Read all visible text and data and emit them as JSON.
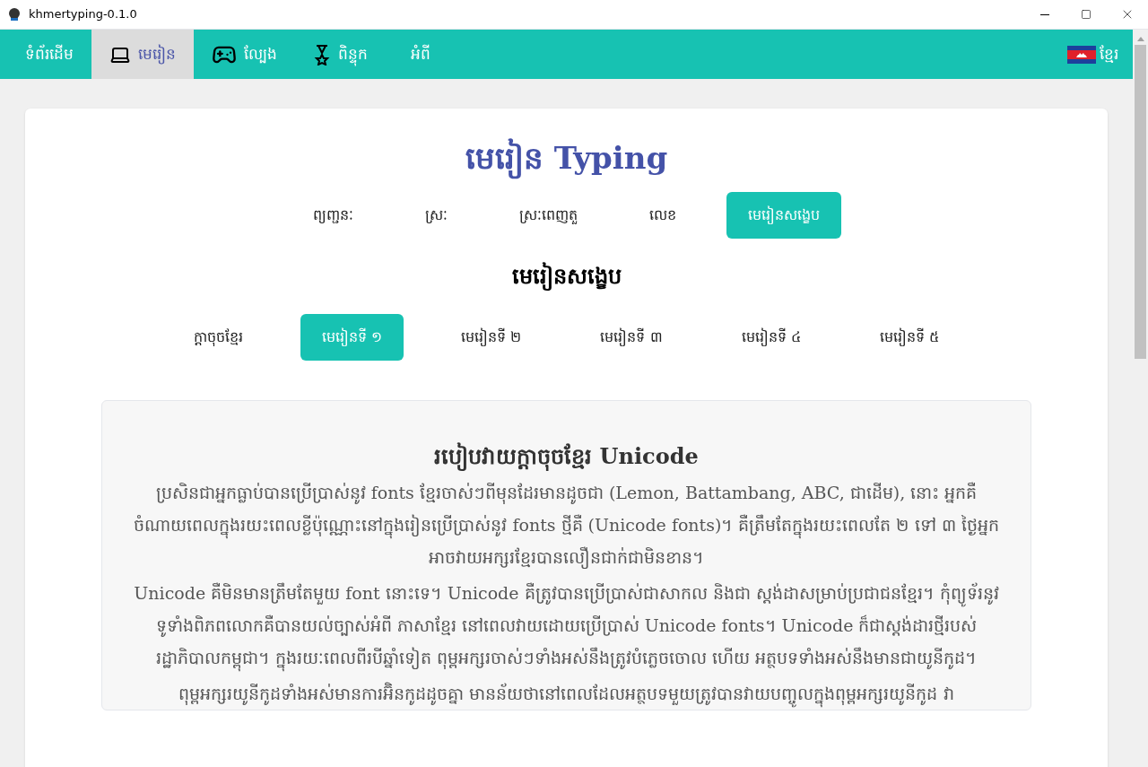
{
  "window": {
    "title": "khmertyping-0.1.0"
  },
  "nav": {
    "items": [
      {
        "label": "ទំព័រដើម",
        "kind": "plain",
        "selected": false
      },
      {
        "label": "មេរៀន",
        "kind": "laptop",
        "selected": true
      },
      {
        "label": "ល្បែង",
        "kind": "gamepad",
        "selected": false
      },
      {
        "label": "ពិន្ទុក",
        "kind": "medal",
        "selected": false
      },
      {
        "label": "អំពី",
        "kind": "plain",
        "selected": false
      }
    ],
    "language": "ខ្មែរ"
  },
  "page": {
    "title": "មេរៀន Typing",
    "categories": [
      {
        "label": "ព្យញ្ជនៈ",
        "selected": false
      },
      {
        "label": "ស្រៈ",
        "selected": false
      },
      {
        "label": "ស្រៈពេញតួ",
        "selected": false
      },
      {
        "label": "លេខ",
        "selected": false
      },
      {
        "label": "មេរៀនសង្ខេប",
        "selected": true
      }
    ],
    "section_title": "មេរៀនសង្ខេប",
    "lessons": [
      {
        "label": "ក្តាចុចខ្មែរ",
        "selected": false
      },
      {
        "label": "មេរៀនទី ១",
        "selected": true
      },
      {
        "label": "មេរៀនទី ២",
        "selected": false
      },
      {
        "label": "មេរៀនទី ៣",
        "selected": false
      },
      {
        "label": "មេរៀនទី ៤",
        "selected": false
      },
      {
        "label": "មេរៀនទី ៥",
        "selected": false
      }
    ],
    "article": {
      "title": "របៀបវាយក្តាចុចខ្មែរ Unicode",
      "paragraphs": [
        "ប្រសិនជាអ្នកធ្លាប់បានប្រើប្រាស់នូវ fonts ខ្មែរចាស់ៗពីមុនដែរមានដូចជា (Lemon, Battambang, ABC, ជាដើម), នោះ អ្នកគឺចំណាយពេលក្នុងរយះពេលខ្លីប៉ុណ្ណោះនៅក្នុងរៀនប្រើប្រាស់នូវ fonts ថ្មីគឺ (Unicode fonts)។ គឺត្រឹមតែក្នុងរយះពេលតែ ២ ទៅ ៣ ថ្ងៃអ្នកអាចវាយអក្សរខ្មែរបានលឿនជាក់ជាមិនខាន។",
        "Unicode គឺមិនមានត្រឹមតែមួយ font នោះទេ។ Unicode គឺត្រូវបានប្រើប្រាស់ជាសាកល និងជា ស្តង់ដាសម្រាប់ប្រជាជនខ្មែរ។ កុំព្យូទ័រនូវទូទាំងពិភពលោកគឺបានយល់ច្បាស់អំពី ភាសាខ្មែរ នៅពេលវាយដោយប្រើប្រាស់ Unicode fonts។ Unicode ក៏ជាស្តង់ដារថ្មីរបស់រដ្ឋាភិបាលកម្ពុជា។ ក្នុងរយៈពេលពីរបីឆ្នាំទៀត ពុម្ពអក្សរចាស់ៗទាំងអស់នឹងត្រូវបំភ្លេចចោល ហើយ អត្ថបទទាំងអស់នឹងមានជាយូនីកូដ។",
        "ពុម្ពអក្សរយូនីកូដទាំងអស់មានការអ៊ិនកូដដូចគ្នា មានន័យថានៅពេលដែលអត្ថបទមួយត្រូវបានវាយបញ្ចូលក្នុងពុម្ពអក្សរយូនីកូដ វា"
      ]
    }
  }
}
